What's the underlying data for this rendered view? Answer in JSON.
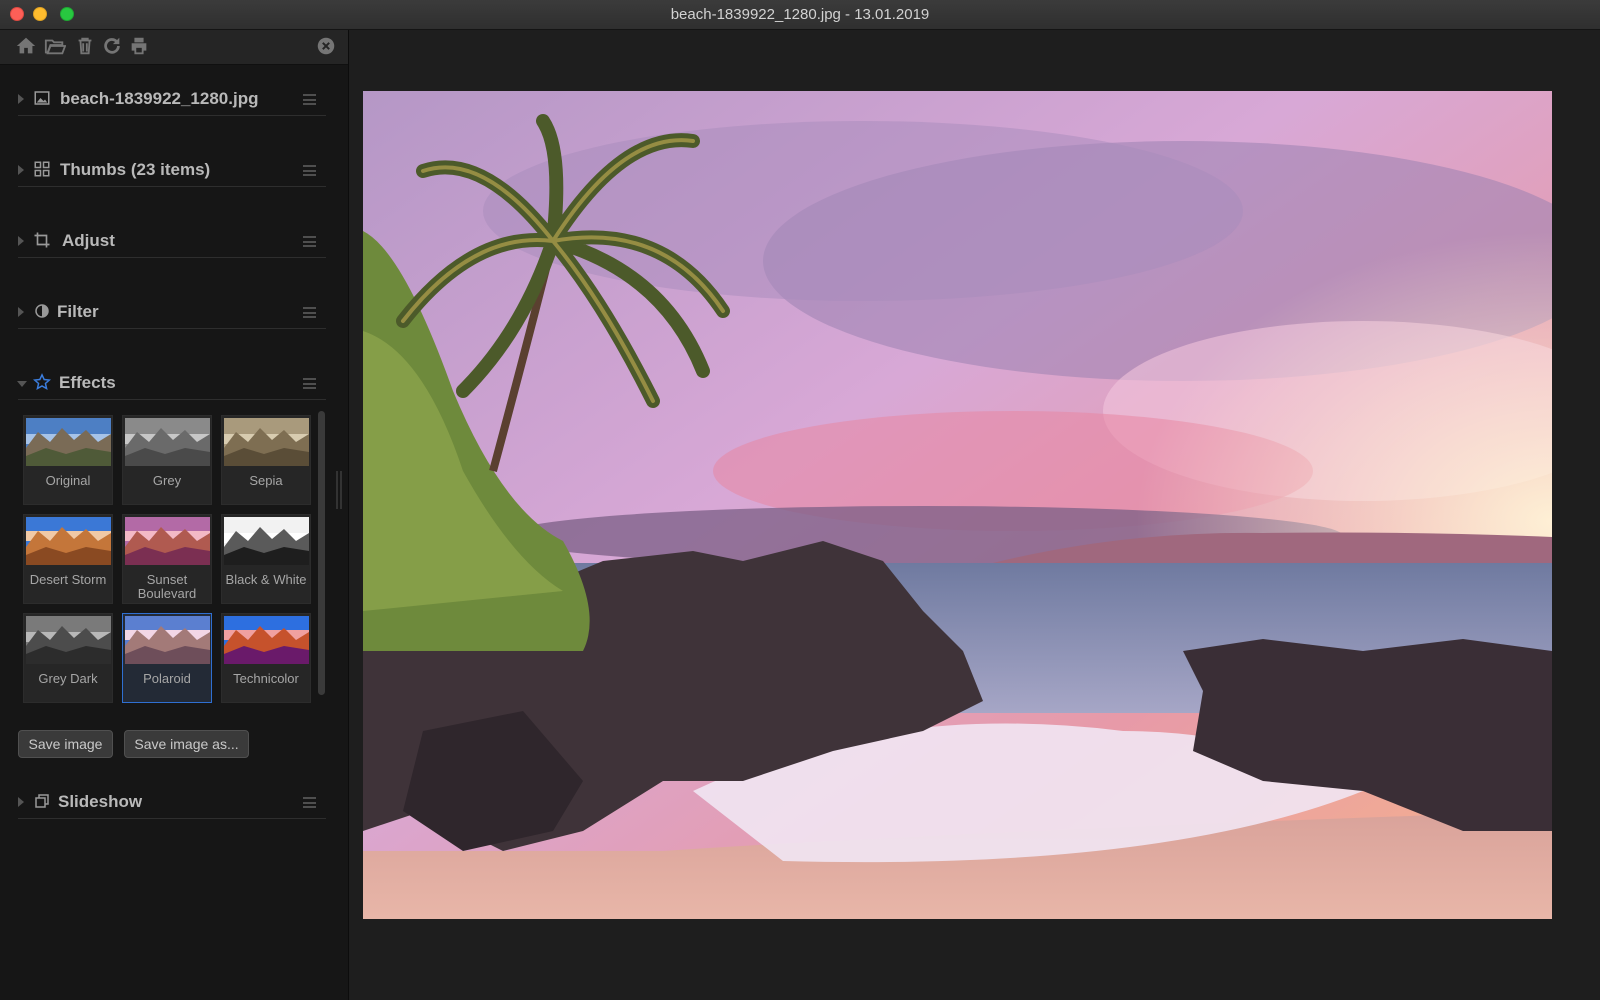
{
  "window": {
    "title": "beach-1839922_1280.jpg - 13.01.2019"
  },
  "toolbar": {
    "icons": [
      "home-icon",
      "folder-open-icon",
      "trash-icon",
      "refresh-icon",
      "print-icon",
      "close-icon"
    ]
  },
  "sidebar": {
    "sections": [
      {
        "label": "beach-1839922_1280.jpg",
        "icon": "image-icon",
        "expanded": false
      },
      {
        "label": "Thumbs (23 items)",
        "icon": "grid-icon",
        "expanded": false
      },
      {
        "label": "Adjust",
        "icon": "crop-icon",
        "expanded": false
      },
      {
        "label": "Filter",
        "icon": "contrast-icon",
        "expanded": false
      },
      {
        "label": "Effects",
        "icon": "star-icon",
        "expanded": true
      },
      {
        "label": "Slideshow",
        "icon": "slideshow-icon",
        "expanded": false
      }
    ],
    "effects": {
      "items": [
        {
          "label": "Original"
        },
        {
          "label": "Grey"
        },
        {
          "label": "Sepia"
        },
        {
          "label": "Desert Storm"
        },
        {
          "label": "Sunset Boulevard"
        },
        {
          "label": "Black & White"
        },
        {
          "label": "Grey Dark"
        },
        {
          "label": "Polaroid"
        },
        {
          "label": "Technicolor"
        }
      ],
      "selected": "Polaroid"
    },
    "buttons": {
      "save": "Save image",
      "save_as": "Save image as..."
    }
  },
  "colors": {
    "accent": "#2f6fd1",
    "star": "#3b7ddd"
  }
}
